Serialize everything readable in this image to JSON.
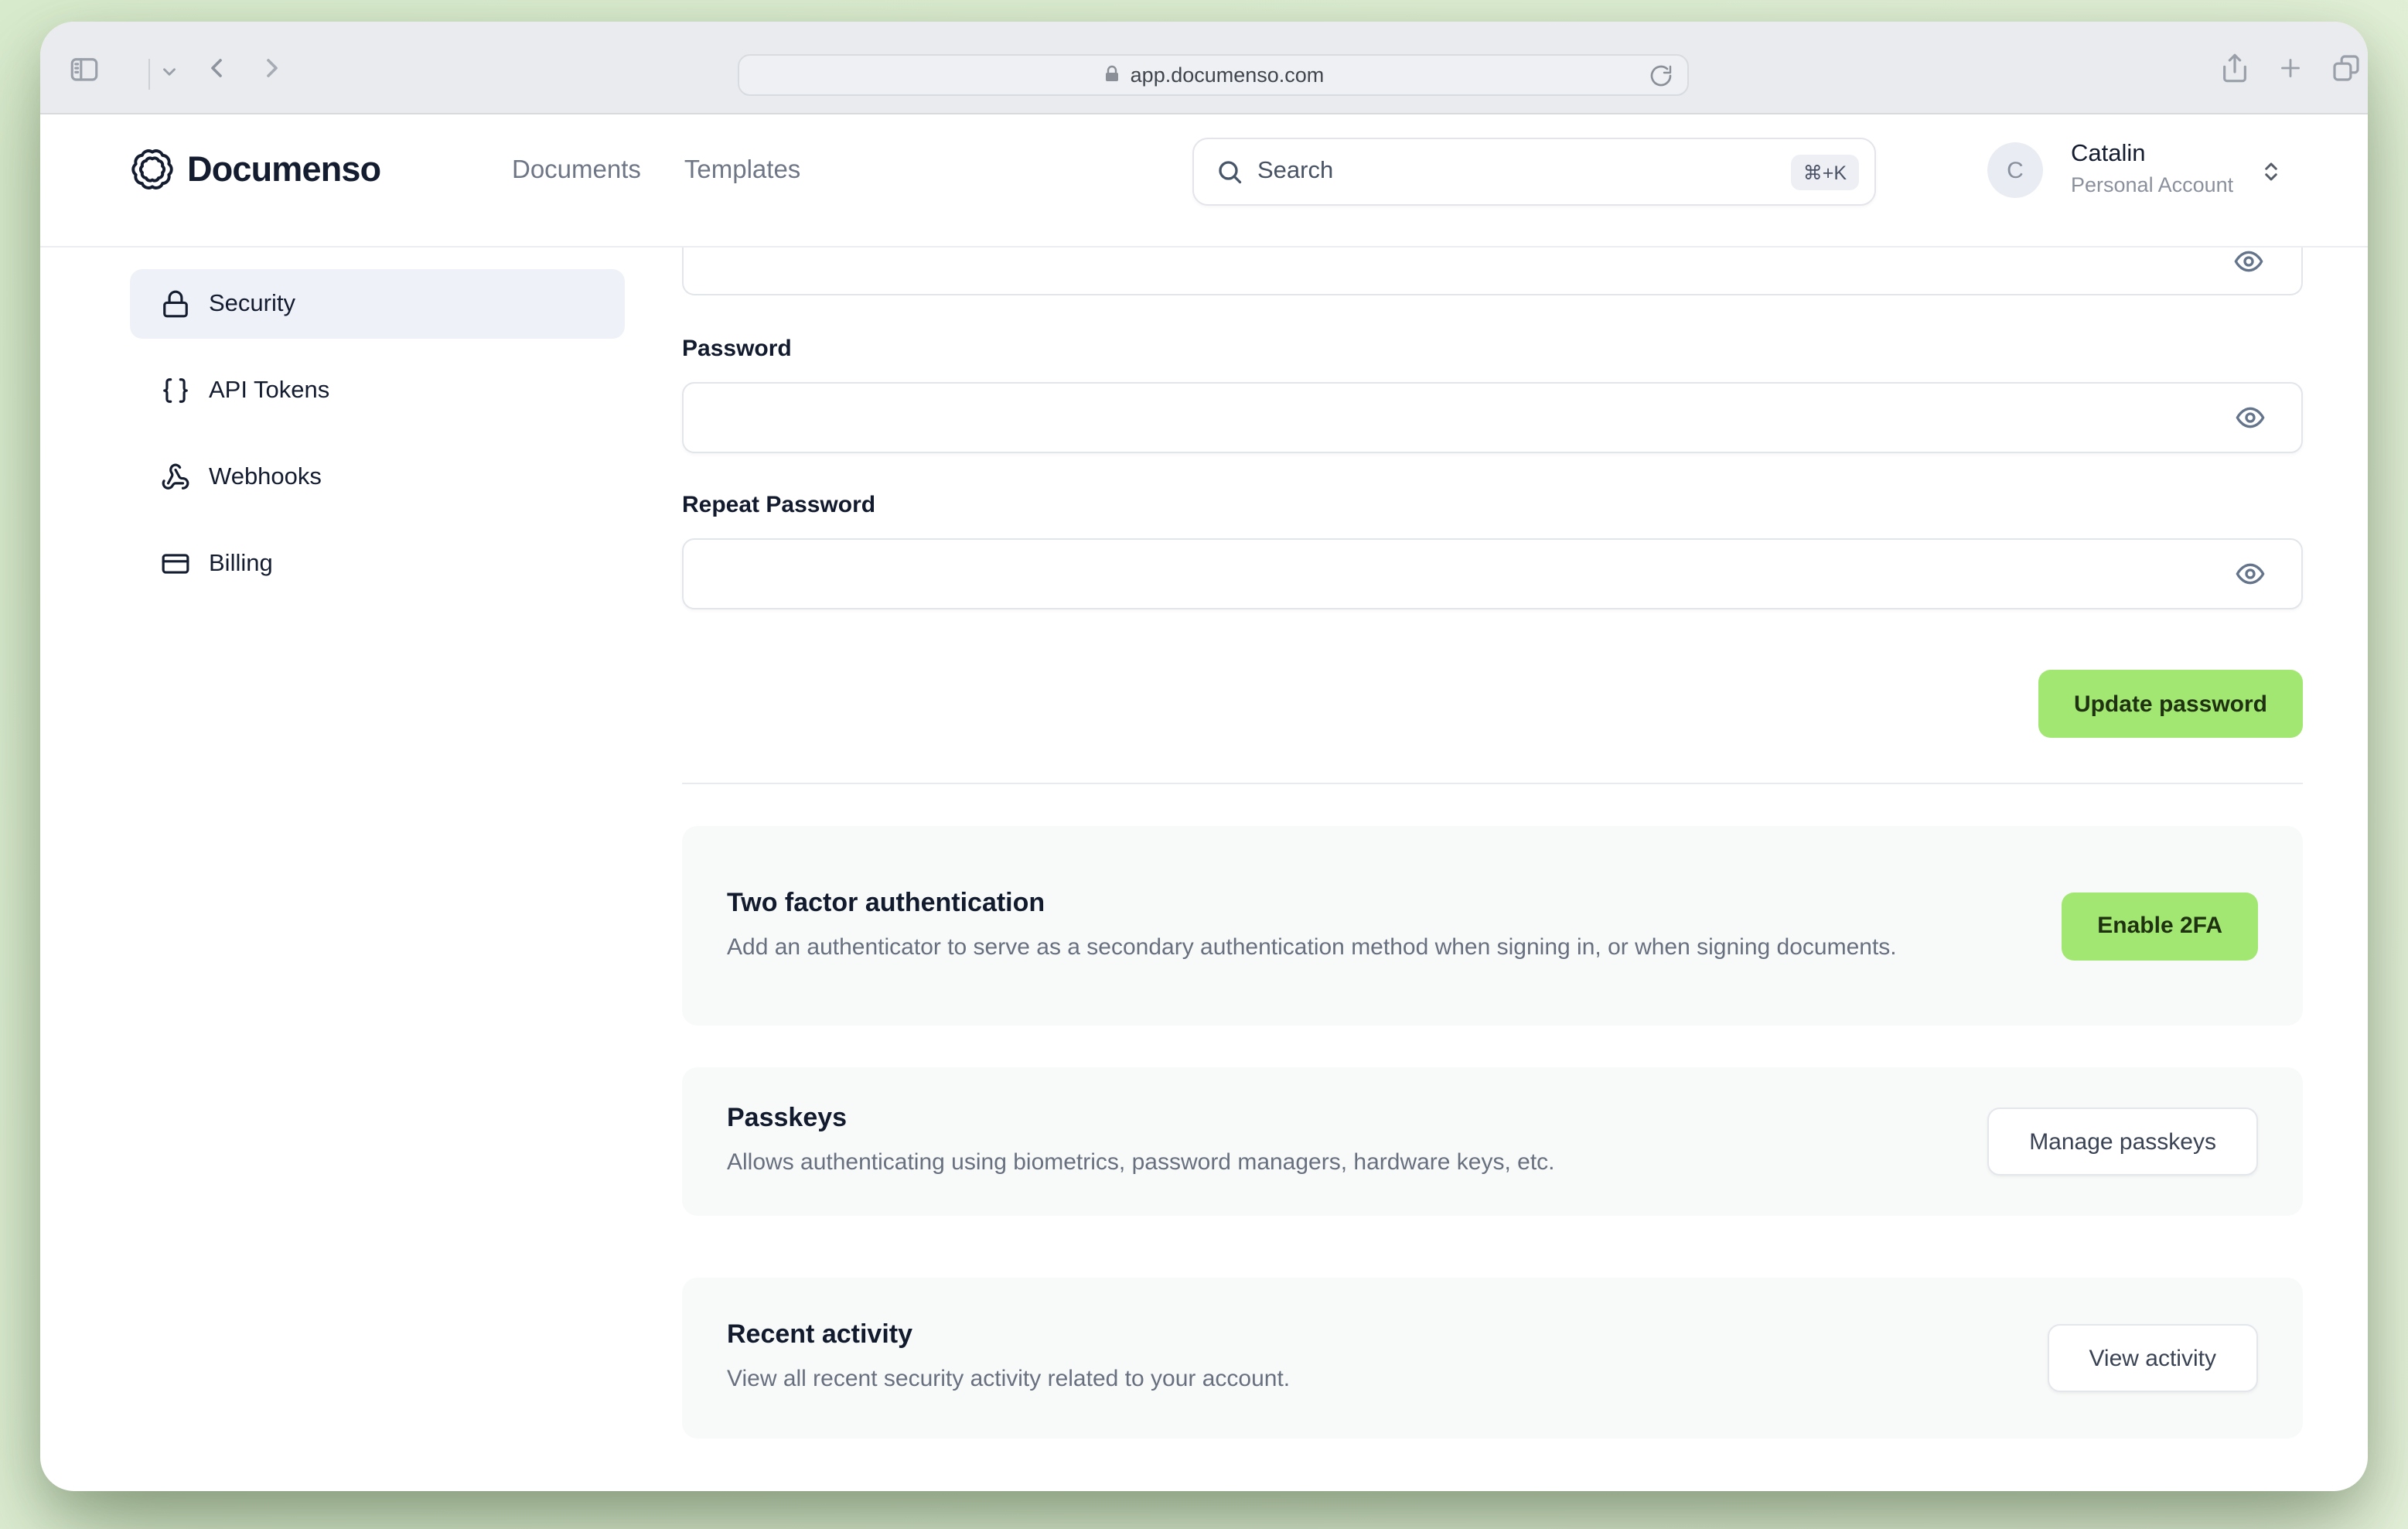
{
  "browser": {
    "url": "app.documenso.com"
  },
  "header": {
    "logo_text": "Documenso",
    "nav": [
      {
        "label": "Documents"
      },
      {
        "label": "Templates"
      }
    ],
    "search": {
      "placeholder": "Search",
      "shortcut": "⌘+K"
    },
    "account": {
      "initial": "C",
      "name": "Catalin",
      "subtitle": "Personal Account"
    }
  },
  "sidebar": {
    "items": [
      {
        "label": "Security",
        "icon": "lock-icon",
        "active": true
      },
      {
        "label": "API Tokens",
        "icon": "braces-icon",
        "active": false
      },
      {
        "label": "Webhooks",
        "icon": "webhook-icon",
        "active": false
      },
      {
        "label": "Billing",
        "icon": "credit-card-icon",
        "active": false
      }
    ]
  },
  "content": {
    "form": {
      "password_label": "Password",
      "repeat_password_label": "Repeat Password",
      "submit_label": "Update password"
    },
    "sections": [
      {
        "title": "Two factor authentication",
        "description": "Add an authenticator to serve as a secondary authentication method when signing in, or when signing documents.",
        "action": "Enable 2FA"
      },
      {
        "title": "Passkeys",
        "description": "Allows authenticating using biometrics, password managers, hardware keys, etc.",
        "action": "Manage passkeys"
      },
      {
        "title": "Recent activity",
        "description": "View all recent security activity related to your account.",
        "action": "View activity"
      }
    ]
  },
  "colors": {
    "accent_green": "#a2e771",
    "accent_green_text": "#1e3110",
    "background_green": "#e0efd5",
    "dark_navy": "#141c30"
  }
}
